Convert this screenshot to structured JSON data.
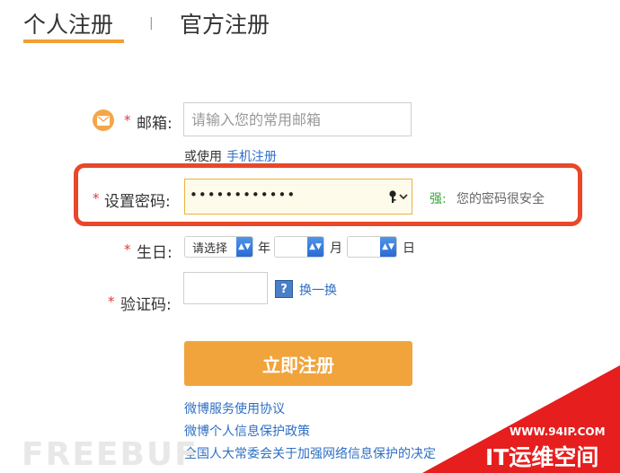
{
  "tabs": {
    "personal": "个人注册",
    "separator": "|",
    "official": "官方注册"
  },
  "email": {
    "required": "*",
    "label": "邮箱:",
    "placeholder": "请输入您的常用邮箱",
    "alt_prefix": "或使用",
    "alt_link": "手机注册"
  },
  "password": {
    "required": "*",
    "label": "设置密码:",
    "value_masked": "••••••••••••",
    "strength_label": "强:",
    "strength_message": "您的密码很安全"
  },
  "birthday": {
    "required": "*",
    "label": "生日:",
    "year_selected": "请选择",
    "year_unit": "年",
    "month_selected": "",
    "month_unit": "月",
    "day_selected": "",
    "day_unit": "日"
  },
  "captcha": {
    "required": "*",
    "label": "验证码:",
    "refresh_label": "换一换"
  },
  "submit_label": "立即注册",
  "agreements": [
    "微博服务使用协议",
    "微博个人信息保护政策",
    "全国人大常委会关于加强网络信息保护的决定"
  ],
  "watermarks": {
    "left": "FREEBUF",
    "url": "WWW.94IP.COM",
    "brand": "IT运维空间"
  },
  "colors": {
    "accent_orange": "#f1a43b",
    "highlight_red": "#e8472a",
    "link_blue": "#2f6fc2",
    "strong_green": "#3aa63a"
  }
}
